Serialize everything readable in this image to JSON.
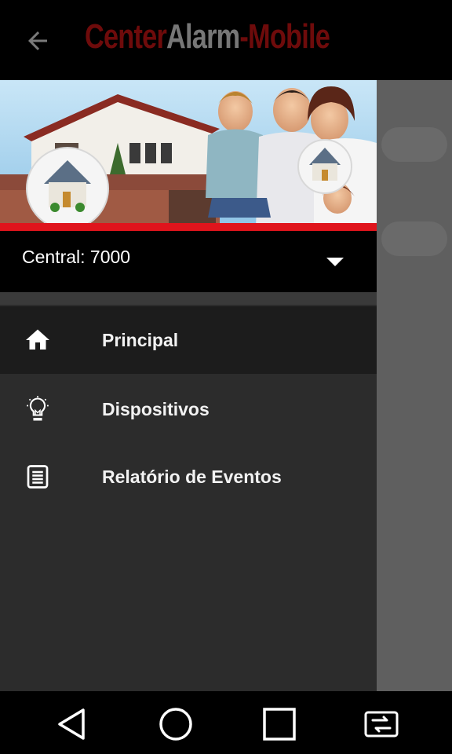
{
  "app": {
    "title_part1": "Center",
    "title_part2": "Alarm",
    "title_part3": "-Mobile"
  },
  "drawer": {
    "central_label": "Central: 7000",
    "items": [
      {
        "label": "Principal",
        "icon": "home-icon",
        "active": true
      },
      {
        "label": "Dispositivos",
        "icon": "lightbulb-icon",
        "active": false
      },
      {
        "label": "Relatório de Eventos",
        "icon": "report-icon",
        "active": false
      }
    ]
  },
  "colors": {
    "accent_red": "#e0141c",
    "title_red": "#6e0b0b",
    "drawer_bg": "#2c2c2c"
  }
}
